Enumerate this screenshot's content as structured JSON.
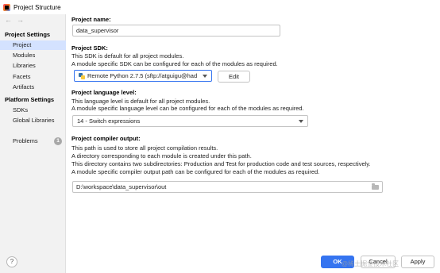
{
  "window": {
    "title": "Project Structure"
  },
  "nav": {
    "back_icon": "arrow-left-icon",
    "forward_icon": "arrow-right-icon"
  },
  "sidebar": {
    "project_settings_header": "Project Settings",
    "project_settings_items": [
      {
        "label": "Project",
        "selected": true
      },
      {
        "label": "Modules"
      },
      {
        "label": "Libraries"
      },
      {
        "label": "Facets"
      },
      {
        "label": "Artifacts"
      }
    ],
    "platform_settings_header": "Platform Settings",
    "platform_settings_items": [
      {
        "label": "SDKs"
      },
      {
        "label": "Global Libraries"
      }
    ],
    "problems": {
      "label": "Problems",
      "count": "1"
    },
    "help_label": "?"
  },
  "project": {
    "name_label": "Project name:",
    "name_value": "data_supervisor",
    "sdk_label": "Project SDK:",
    "sdk_desc1": "This SDK is default for all project modules.",
    "sdk_desc2": "A module specific SDK can be configured for each of the modules as required.",
    "sdk_value": "Remote Python 2.7.5 (sftp://atguigu@had",
    "sdk_edit_label": "Edit",
    "language_label": "Project language level:",
    "language_desc1": "This language level is default for all project modules.",
    "language_desc2": "A module specific language level can be configured for each of the modules as required.",
    "language_value": "14 - Switch expressions",
    "compiler_label": "Project compiler output:",
    "compiler_desc1": "This path is used to store all project compilation results.",
    "compiler_desc2": "A directory corresponding to each module is created under this path.",
    "compiler_desc3": "This directory contains two subdirectories: Production and Test for production code and test sources, respectively.",
    "compiler_desc4": "A module specific compiler output path can be configured for each of the modules as required.",
    "compiler_value": "D:\\workspace\\data_supervisor\\out"
  },
  "footer": {
    "ok_label": "OK",
    "cancel_label": "Cancel",
    "apply_label": "Apply",
    "watermark": "@稀土掘金技术社区"
  },
  "colors": {
    "accent": "#3574f0",
    "selected_bg": "#d4e2ff",
    "sidebar_bg": "#f2f2f2"
  }
}
